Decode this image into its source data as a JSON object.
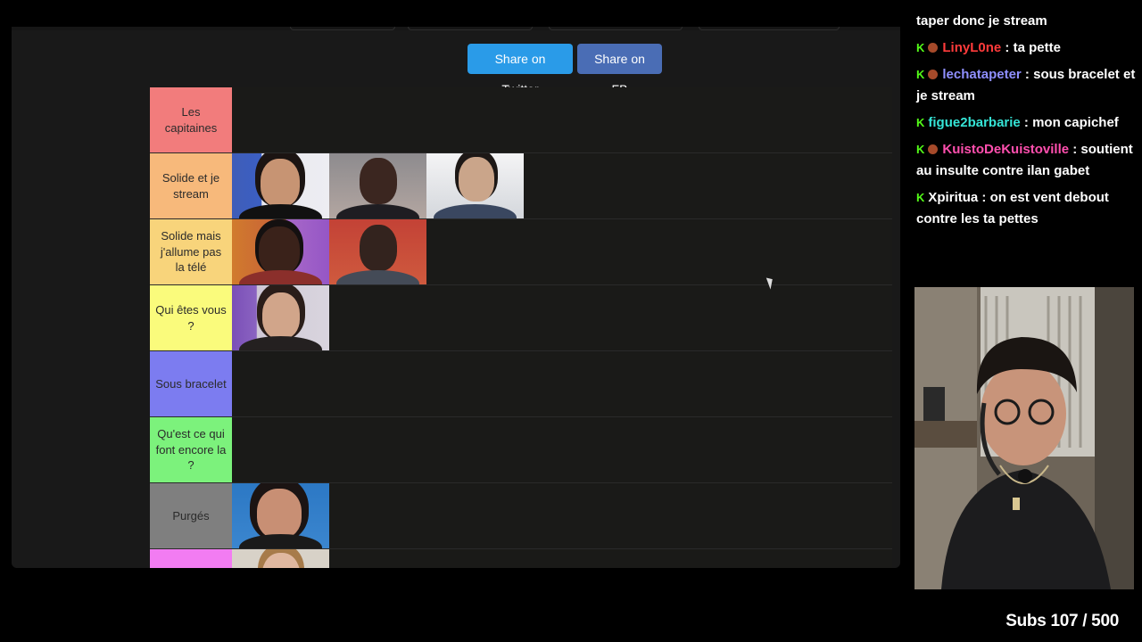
{
  "share": {
    "twitter_label": "Share on Twitter",
    "fb_label": "Share on FB"
  },
  "tiers": [
    {
      "label": "Les capitaines",
      "color": "#f27c7c",
      "items": []
    },
    {
      "label": "Solide et je stream",
      "color": "#f7b97b",
      "items": [
        "portrait-1",
        "portrait-2",
        "portrait-3"
      ]
    },
    {
      "label": "Solide mais j'allume pas la télé",
      "color": "#f8d47b",
      "items": [
        "portrait-4",
        "portrait-5"
      ]
    },
    {
      "label": "Qui êtes vous ?",
      "color": "#fafb7c",
      "items": [
        "portrait-6"
      ]
    },
    {
      "label": "Sous bracelet",
      "color": "#7c7cf0",
      "items": []
    },
    {
      "label": "Qu'est ce qui font encore la ?",
      "color": "#7cf27c",
      "items": []
    },
    {
      "label": "Purgés",
      "color": "#7f7f7f",
      "items": [
        "portrait-7"
      ]
    }
  ],
  "chat": {
    "messages": [
      {
        "user": "",
        "text": "taper donc je stream",
        "user_color": "#53fc18"
      },
      {
        "user": "LinyL0ne",
        "text": " : ta pette",
        "user_color": "#ff3b3b"
      },
      {
        "user": "lechatapeter",
        "text": " : sous bracelet et je stream",
        "user_color": "#8f8fff"
      },
      {
        "user": "figue2barbarie",
        "text": " : mon capichef",
        "user_color": "#35e4d6"
      },
      {
        "user": "KuistoDeKuistoville",
        "text": " : soutient au insulte contre ilan gabet",
        "user_color": "#ff4fae"
      },
      {
        "user": "Xpiritua",
        "text": " : on est vent debout contre les ta pettes",
        "user_color": "#ffffff"
      }
    ]
  },
  "stream": {
    "subs_text": "Subs 107 / 500"
  },
  "icons": {
    "platform_badge": "kick-badge-icon",
    "sub_badge": "sub-badge-icon",
    "cursor": "mouse-cursor-icon"
  }
}
